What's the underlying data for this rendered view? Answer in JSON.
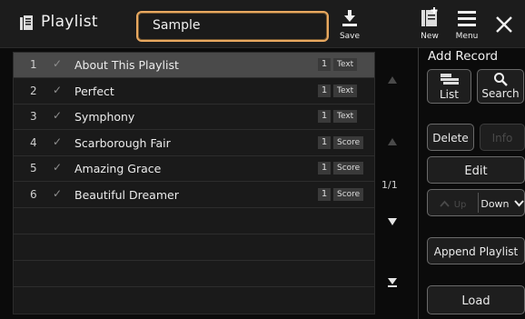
{
  "header": {
    "title": "Playlist",
    "name_value": "Sample",
    "save_label": "Save",
    "new_label": "New",
    "menu_label": "Menu"
  },
  "list": {
    "rows": [
      {
        "num": "1",
        "name": "About This Playlist",
        "count": "1",
        "type": "Text"
      },
      {
        "num": "2",
        "name": "Perfect",
        "count": "1",
        "type": "Text"
      },
      {
        "num": "3",
        "name": "Symphony",
        "count": "1",
        "type": "Text"
      },
      {
        "num": "4",
        "name": "Scarborough Fair",
        "count": "1",
        "type": "Score"
      },
      {
        "num": "5",
        "name": "Amazing Grace",
        "count": "1",
        "type": "Score"
      },
      {
        "num": "6",
        "name": "Beautiful Dreamer",
        "count": "1",
        "type": "Score"
      }
    ],
    "page_indicator": "1/1"
  },
  "panel": {
    "add_record": "Add Record",
    "list_label": "List",
    "search_label": "Search",
    "delete_label": "Delete",
    "info_label": "Info",
    "edit_label": "Edit",
    "up_label": "Up",
    "down_label": "Down",
    "append_label": "Append Playlist",
    "load_label": "Load"
  },
  "colors": {
    "accent": "#e8a860",
    "selected_row": "#4a4a4a"
  }
}
